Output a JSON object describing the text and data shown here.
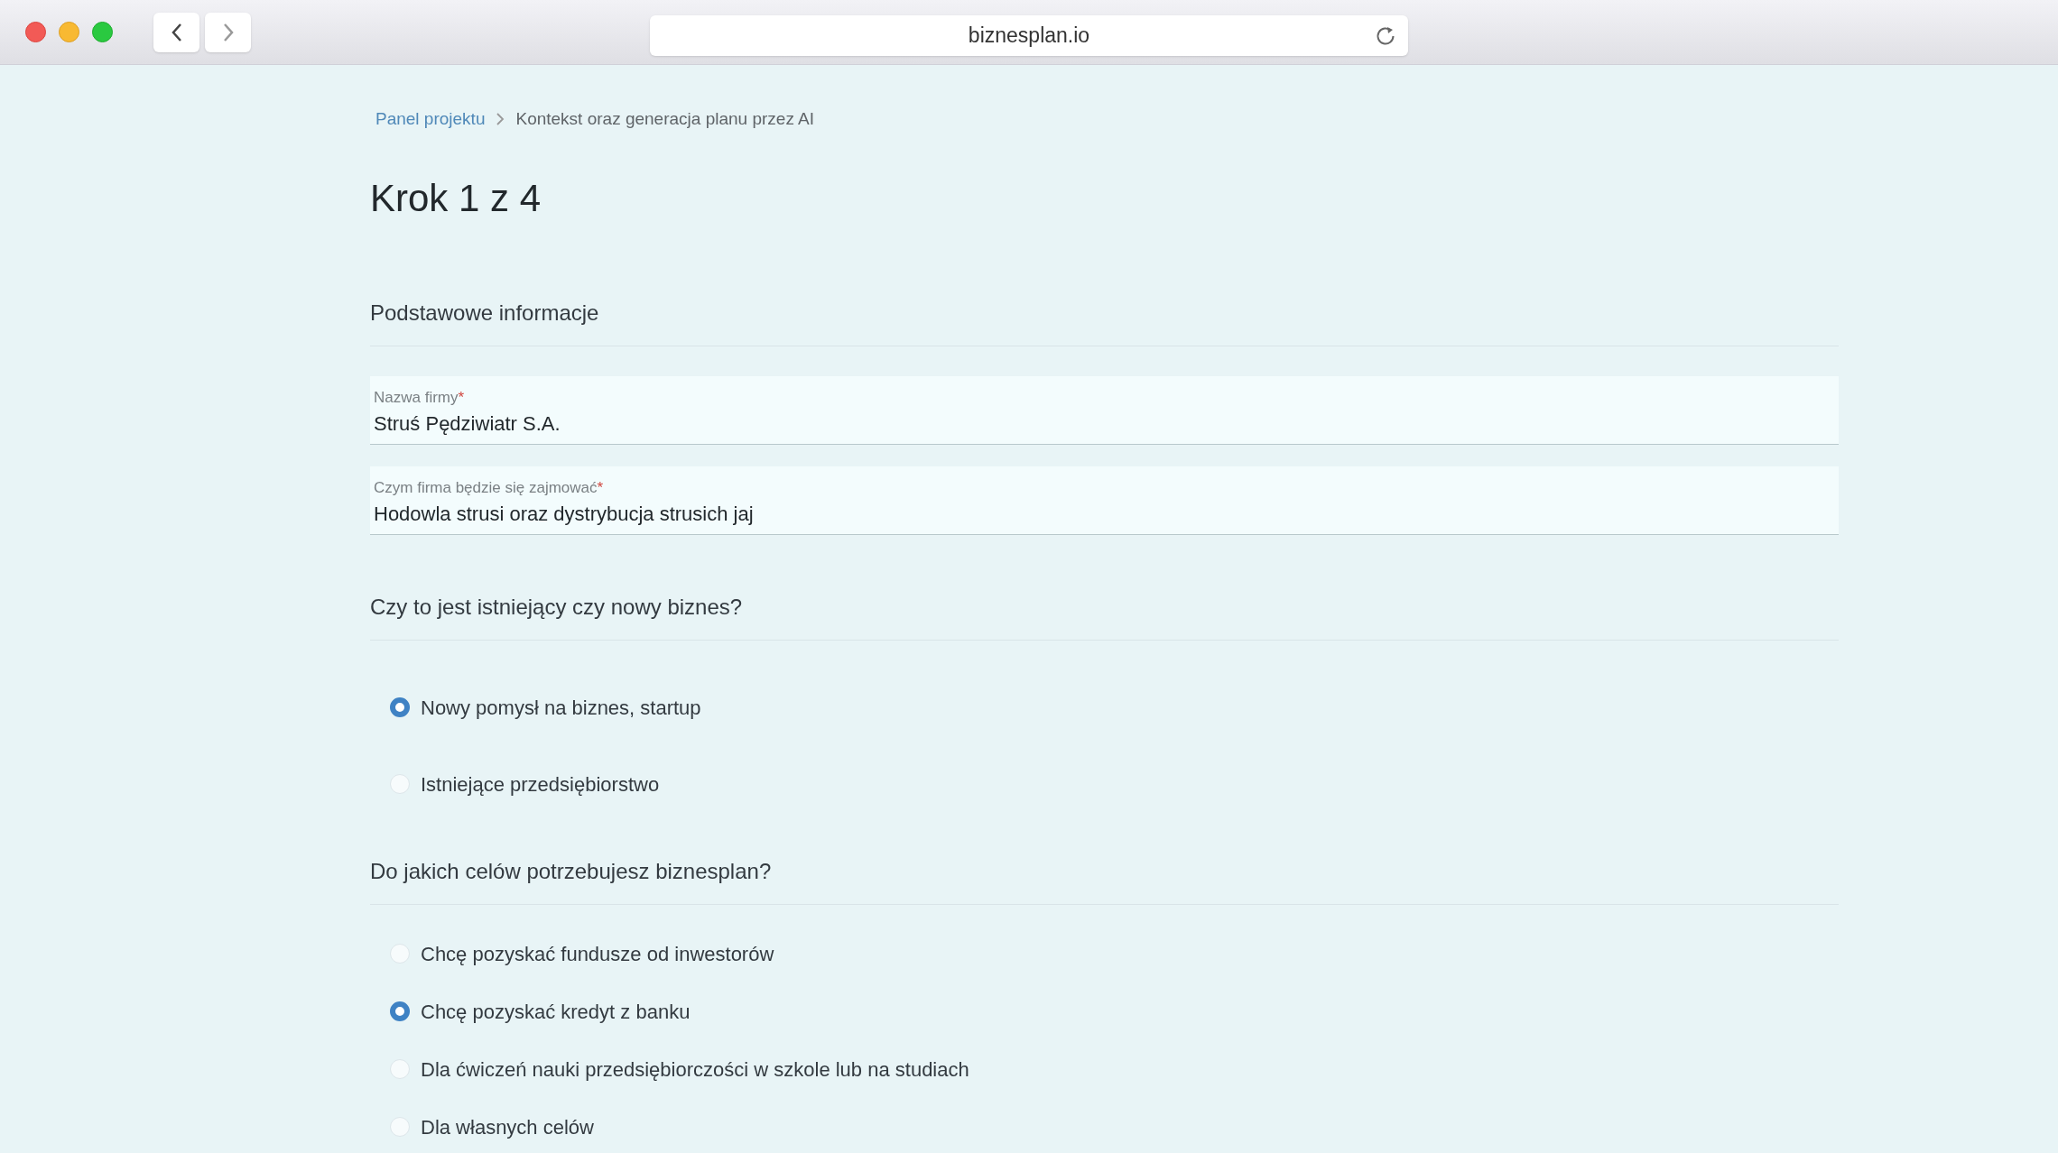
{
  "browser": {
    "url": "biznesplan.io"
  },
  "breadcrumb": [
    {
      "label": "Panel projektu",
      "kind": "link"
    },
    {
      "label": "Kontekst oraz generacja planu przez AI",
      "kind": "current"
    }
  ],
  "title": "Krok 1 z 4",
  "sections": [
    {
      "heading": "Podstawowe informacje",
      "kind": "fields",
      "fields": [
        {
          "label": "Nazwa firmy",
          "required_mark": "*",
          "value": "Struś Pędziwiatr S.A."
        },
        {
          "label": "Czym firma będzie się zajmować",
          "required_mark": "*",
          "value": "Hodowla strusi oraz dystrybucja strusich jaj"
        }
      ]
    },
    {
      "heading": "Czy to jest istniejący czy nowy biznes?",
      "kind": "radios",
      "options": [
        {
          "label": "Nowy pomysł na biznes, startup",
          "selected": true
        },
        {
          "label": "Istniejące przedsiębiorstwo",
          "selected": false
        }
      ]
    },
    {
      "heading": "Do jakich celów potrzebujesz biznesplan?",
      "kind": "radios",
      "options": [
        {
          "label": "Chcę pozyskać fundusze od inwestorów",
          "selected": false
        },
        {
          "label": "Chcę pozyskać kredyt z banku",
          "selected": true
        },
        {
          "label": "Dla ćwiczeń nauki przedsiębiorczości w szkole lub na studiach",
          "selected": false
        },
        {
          "label": "Dla własnych celów",
          "selected": false
        }
      ]
    }
  ]
}
